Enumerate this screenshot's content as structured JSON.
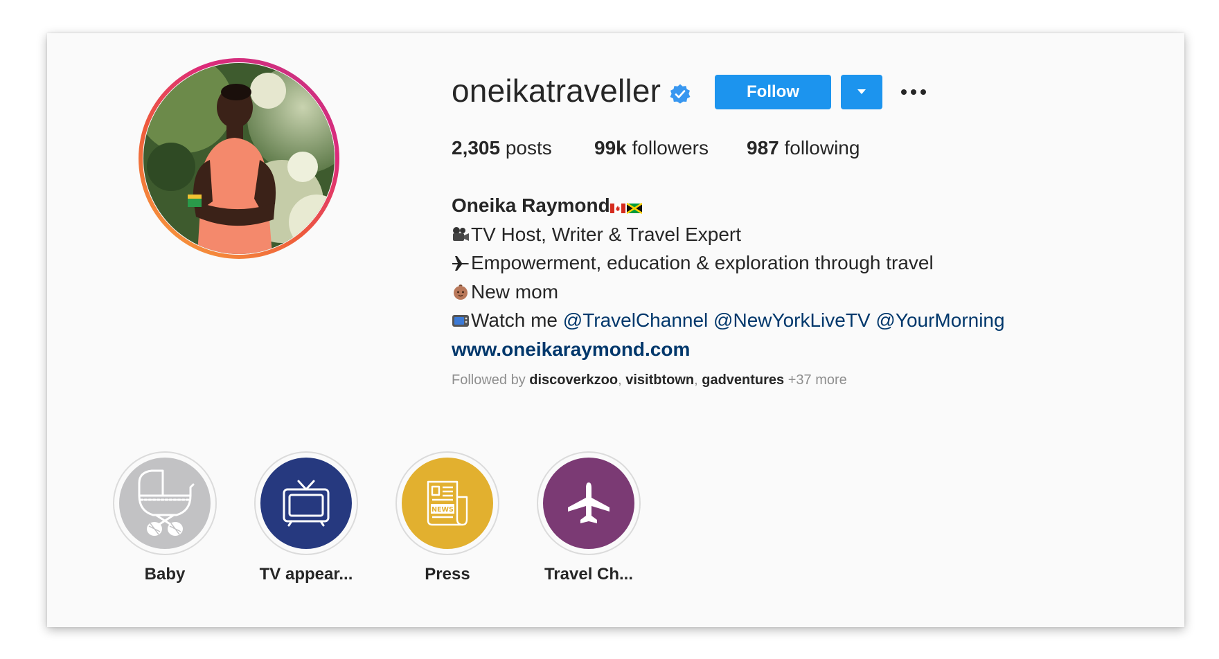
{
  "profile": {
    "username": "oneikatraveller",
    "verified": true,
    "follow_label": "Follow",
    "stats": {
      "posts_count": "2,305",
      "posts_label": "posts",
      "followers_count": "99k",
      "followers_label": "followers",
      "following_count": "987",
      "following_label": "following"
    },
    "bio": {
      "name": "Oneika Raymond",
      "line1": "TV Host, Writer & Travel Expert",
      "line2": "Empowerment, education & exploration through travel",
      "line3": "New mom",
      "line4_prefix": "Watch me",
      "mentions": [
        "@TravelChannel",
        "@NewYorkLiveTV",
        "@YourMorning"
      ],
      "website": "www.oneikaraymond.com"
    },
    "followed_by": {
      "prefix": "Followed by",
      "accounts": [
        "discoverkzoo",
        "visitbtown",
        "gadventures"
      ],
      "more": "+37 more"
    }
  },
  "highlights": [
    {
      "label": "Baby",
      "icon": "baby-carriage-icon",
      "color": "#c2c2c4"
    },
    {
      "label": "TV appear...",
      "icon": "tv-icon",
      "color": "#26397f"
    },
    {
      "label": "Press",
      "icon": "newspaper-icon",
      "color": "#e2b02f"
    },
    {
      "label": "Travel Ch...",
      "icon": "airplane-icon",
      "color": "#7b3a74"
    }
  ],
  "colors": {
    "button_blue": "#1c94ee",
    "link_blue": "#00376b",
    "verified_blue": "#3897f0"
  }
}
